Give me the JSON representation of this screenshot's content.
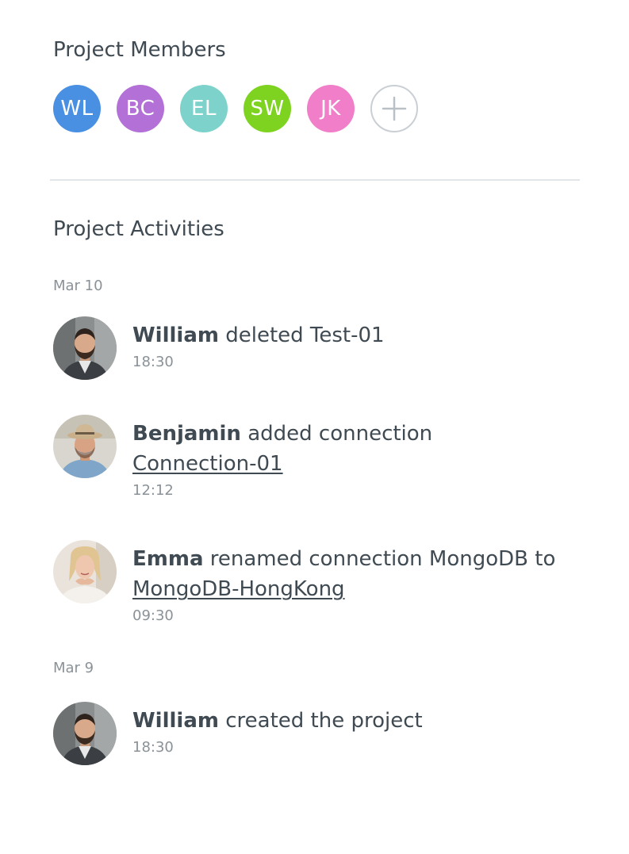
{
  "members_section": {
    "title": "Project Members",
    "members": [
      {
        "initials": "WL",
        "color": "#4a90e2"
      },
      {
        "initials": "BC",
        "color": "#b370d6"
      },
      {
        "initials": "EL",
        "color": "#7dd3cc"
      },
      {
        "initials": "SW",
        "color": "#7ed321"
      },
      {
        "initials": "JK",
        "color": "#f07ec8"
      }
    ],
    "add_icon": "plus-icon"
  },
  "activities_section": {
    "title": "Project Activities",
    "groups": [
      {
        "date": "Mar 10",
        "items": [
          {
            "actor": "William",
            "text": "deleted Test-01",
            "link": "",
            "time": "18:30"
          },
          {
            "actor": "Benjamin",
            "text": "added connection",
            "link": "Connection-01",
            "time": "12:12"
          },
          {
            "actor": "Emma",
            "text": "renamed connection MongoDB to",
            "link": "MongoDB-HongKong",
            "time": "09:30"
          }
        ]
      },
      {
        "date": "Mar 9",
        "items": [
          {
            "actor": "William",
            "text": "created the project",
            "link": "",
            "time": "18:30"
          }
        ]
      }
    ]
  }
}
